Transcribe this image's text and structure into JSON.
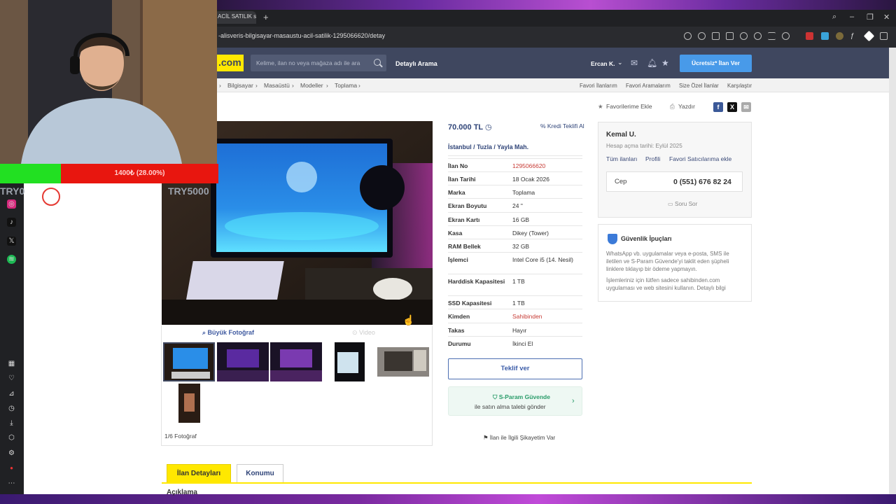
{
  "browser": {
    "tab_title": "ACİL SATILIK sa",
    "url": "-alisveris-bilgisayar-masaustu-acil-satilik-1295066620/detay"
  },
  "header": {
    "logo": ".com",
    "search_placeholder": "Kelime, ilan no veya mağaza adı ile ara",
    "detailed_search": "Detaylı Arama",
    "user": "Ercan K.",
    "post_button": "Ücretsiz* İlan Ver"
  },
  "breadcrumb": [
    "Bilgisayar",
    "Masaüstü",
    "Modeller",
    "Toplama"
  ],
  "quick_links": [
    "Favori İlanlarım",
    "Favori Aramalarım",
    "Size Özel İlanlar",
    "Karşılaştır"
  ],
  "actions": {
    "favorite": "Favorilerime Ekle",
    "print": "Yazdır"
  },
  "gallery": {
    "big_photo": "Büyük Fotoğraf",
    "video": "Video",
    "count": "1/6 Fotoğraf"
  },
  "listing": {
    "price": "70.000 TL",
    "credit": "Kredi Teklifi Al",
    "location": [
      "İstanbul",
      "Tuzla",
      "Yayla Mah."
    ],
    "details": [
      {
        "label": "İlan No",
        "value": "1295066620",
        "accent": true
      },
      {
        "label": "İlan Tarihi",
        "value": "18 Ocak 2026"
      },
      {
        "label": "Marka",
        "value": "Toplama"
      },
      {
        "label": "Ekran Boyutu",
        "value": "24 \""
      },
      {
        "label": "Ekran Kartı",
        "value": "16 GB"
      },
      {
        "label": "Kasa",
        "value": "Dikey (Tower)"
      },
      {
        "label": "RAM Bellek",
        "value": "32 GB"
      },
      {
        "label": "İşlemci",
        "value": "Intel Core i5 (14. Nesil)"
      },
      {
        "label": "Harddisk Kapasitesi",
        "value": "1 TB"
      },
      {
        "label": "SSD Kapasitesi",
        "value": "1 TB"
      },
      {
        "label": "Kimden",
        "value": "Sahibinden",
        "accent": true
      },
      {
        "label": "Takas",
        "value": "Hayır"
      },
      {
        "label": "Durumu",
        "value": "İkinci El"
      }
    ],
    "offer_button": "Teklif ver",
    "sparam_title": "S-Param Güvende",
    "sparam_sub": "ile satın alma talebi gönder",
    "complaint": "İlan ile İlgili Şikayetim Var"
  },
  "seller": {
    "name": "Kemal U.",
    "joined": "Hesap açma tarihi: Eylül 2025",
    "links": [
      "Tüm ilanları",
      "Profili",
      "Favori Satıcılarıma ekle"
    ],
    "phone_label": "Cep",
    "phone": "0 (551) 676 82 24",
    "ask": "Soru Sor"
  },
  "safety": {
    "title": "Güvenlik İpuçları",
    "p1": "WhatsApp vb. uygulamalar veya e-posta, SMS ile iletilen ve S-Param Güvende'yi taklit eden şüpheli linklere tıklayıp bir ödeme yapmayın.",
    "p2": "İşlemleriniz için lütfen sadece sahibinden.com uygulaması ve web sitesini kullanın. Detaylı bilgi"
  },
  "tabs": [
    "İlan Detayları",
    "Konumu"
  ],
  "section_title": "Açıklama",
  "overlay": {
    "bar_text": "1400₺ (28.00%)",
    "progress_fraction": 0.28,
    "try_left": "TRY0",
    "try_right": "TRY5000"
  },
  "colors": {
    "brand_yellow": "#ffe800",
    "header": "#3f475f",
    "accent_blue": "#489ae9",
    "accent_red": "#c73b35"
  }
}
